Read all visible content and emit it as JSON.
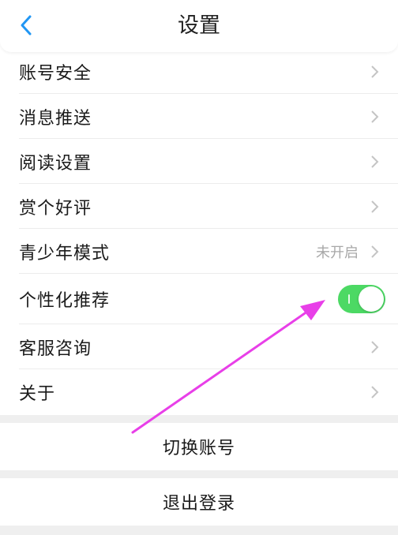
{
  "header": {
    "title": "设置"
  },
  "settings": [
    {
      "label": "账号安全"
    },
    {
      "label": "消息推送"
    },
    {
      "label": "阅读设置"
    },
    {
      "label": "赏个好评"
    },
    {
      "label": "青少年模式",
      "value": "未开启"
    },
    {
      "label": "个性化推荐",
      "toggle": true
    },
    {
      "label": "客服咨询"
    },
    {
      "label": "关于"
    }
  ],
  "actions": {
    "switch_account": "切换账号",
    "logout": "退出登录"
  },
  "colors": {
    "accent": "#2196f3",
    "toggle_on": "#4cd964",
    "annotation_arrow": "#e83fe8",
    "chevron": "#c4c4c4",
    "muted_text": "#a8a8a8",
    "divider": "#efefef"
  },
  "icons": {
    "back": "chevron-left-icon",
    "row_arrow": "chevron-right-icon"
  }
}
